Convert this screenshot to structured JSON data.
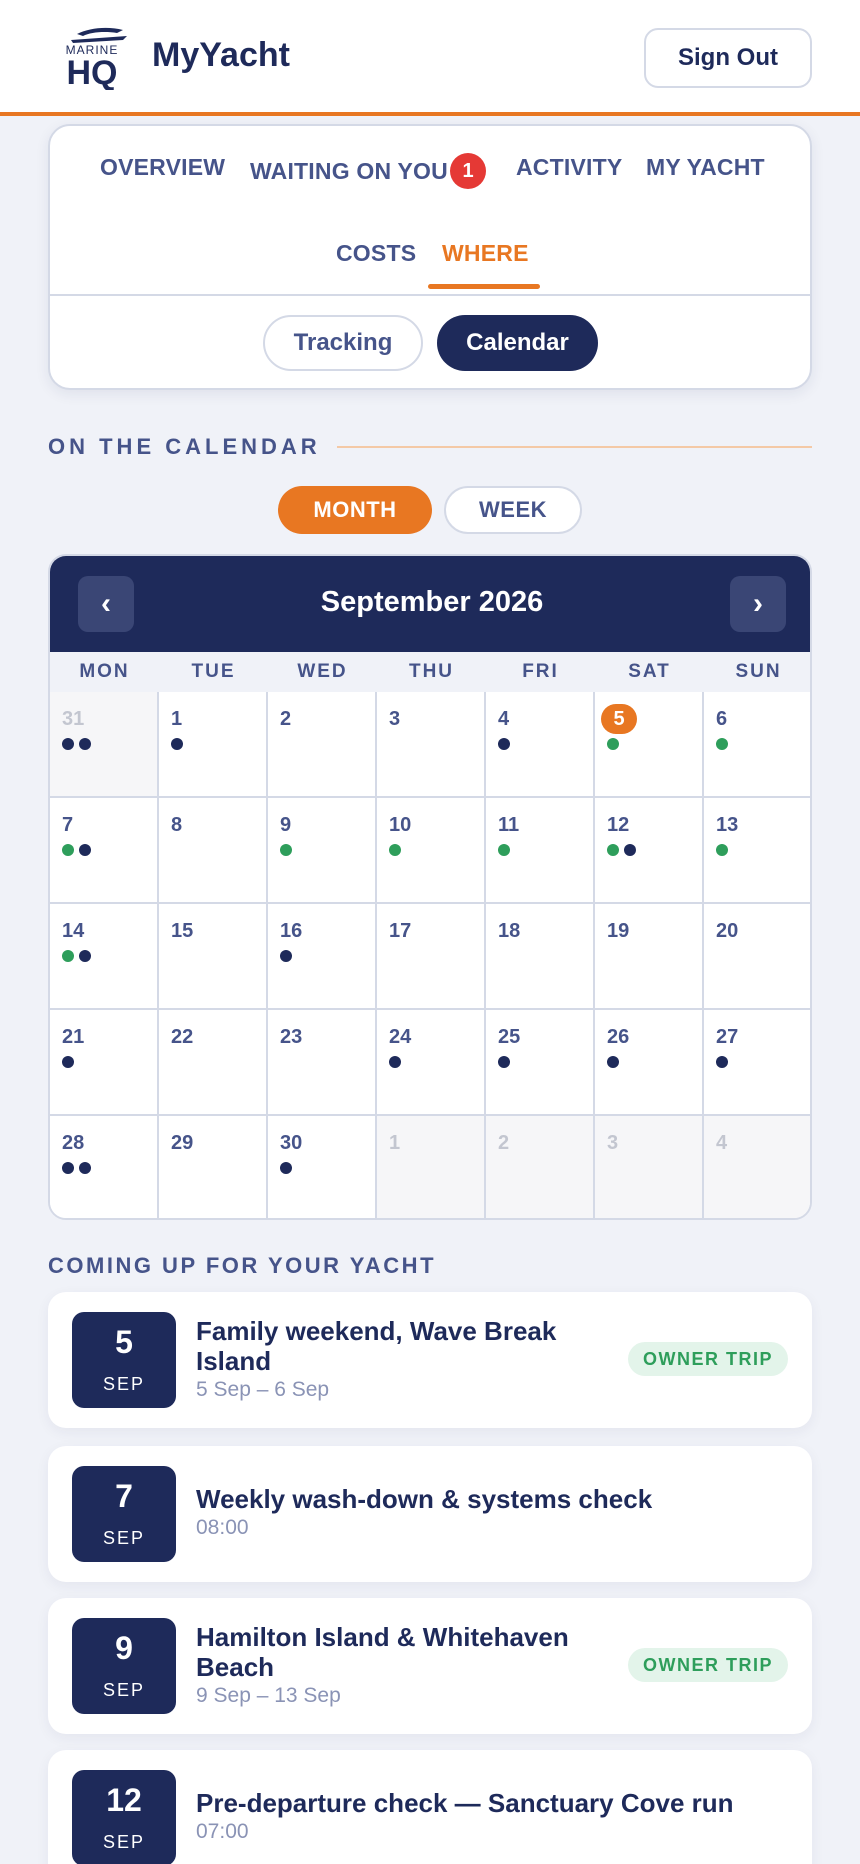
{
  "header": {
    "logo_text_top": "MARINE",
    "logo_text_main": "HQ",
    "app_title": "MyYacht",
    "sign_out_label": "Sign Out"
  },
  "nav": {
    "tabs": [
      {
        "label": "OVERVIEW",
        "active": false
      },
      {
        "label": "WAITING ON YOU",
        "active": false,
        "badge": "1"
      },
      {
        "label": "ACTIVITY",
        "active": false
      },
      {
        "label": "MY YACHT",
        "active": false
      },
      {
        "label": "COSTS",
        "active": false
      },
      {
        "label": "WHERE",
        "active": true
      }
    ],
    "segments": [
      {
        "label": "Tracking",
        "selected": false
      },
      {
        "label": "Calendar",
        "selected": true
      }
    ]
  },
  "calendar_section": {
    "title": "ON THE CALENDAR",
    "view_toggle": [
      {
        "label": "MONTH",
        "selected": true
      },
      {
        "label": "WEEK",
        "selected": false
      }
    ],
    "month_title": "September 2026",
    "prev_icon": "‹",
    "next_icon": "›",
    "weekdays": [
      "MON",
      "TUE",
      "WED",
      "THU",
      "FRI",
      "SAT",
      "SUN"
    ],
    "days": [
      {
        "n": "31",
        "muted": true,
        "dots": [
          "navy",
          "navy"
        ]
      },
      {
        "n": "1",
        "dots": [
          "navy"
        ]
      },
      {
        "n": "2",
        "dots": []
      },
      {
        "n": "3",
        "dots": []
      },
      {
        "n": "4",
        "dots": [
          "navy"
        ]
      },
      {
        "n": "5",
        "today": true,
        "dots": [
          "green"
        ]
      },
      {
        "n": "6",
        "dots": [
          "green"
        ]
      },
      {
        "n": "7",
        "dots": [
          "green",
          "navy"
        ]
      },
      {
        "n": "8",
        "dots": []
      },
      {
        "n": "9",
        "dots": [
          "green"
        ]
      },
      {
        "n": "10",
        "dots": [
          "green"
        ]
      },
      {
        "n": "11",
        "dots": [
          "green"
        ]
      },
      {
        "n": "12",
        "dots": [
          "green",
          "navy"
        ]
      },
      {
        "n": "13",
        "dots": [
          "green"
        ]
      },
      {
        "n": "14",
        "dots": [
          "green",
          "navy"
        ]
      },
      {
        "n": "15",
        "dots": []
      },
      {
        "n": "16",
        "dots": [
          "navy"
        ]
      },
      {
        "n": "17",
        "dots": []
      },
      {
        "n": "18",
        "dots": []
      },
      {
        "n": "19",
        "dots": []
      },
      {
        "n": "20",
        "dots": []
      },
      {
        "n": "21",
        "dots": [
          "navy"
        ]
      },
      {
        "n": "22",
        "dots": []
      },
      {
        "n": "23",
        "dots": []
      },
      {
        "n": "24",
        "dots": [
          "navy"
        ]
      },
      {
        "n": "25",
        "dots": [
          "navy"
        ]
      },
      {
        "n": "26",
        "dots": [
          "navy"
        ]
      },
      {
        "n": "27",
        "dots": [
          "navy"
        ]
      },
      {
        "n": "28",
        "dots": [
          "navy",
          "navy"
        ]
      },
      {
        "n": "29",
        "dots": []
      },
      {
        "n": "30",
        "dots": [
          "navy"
        ]
      },
      {
        "n": "1",
        "muted": true,
        "dots": []
      },
      {
        "n": "2",
        "muted": true,
        "dots": []
      },
      {
        "n": "3",
        "muted": true,
        "dots": []
      },
      {
        "n": "4",
        "muted": true,
        "dots": []
      }
    ]
  },
  "upcoming": {
    "title": "COMING UP FOR YOUR YACHT",
    "events": [
      {
        "day": "5",
        "month": "SEP",
        "title_lines": [
          "Family weekend, Wave Break",
          "Island"
        ],
        "subtitle": "5 Sep – 6 Sep",
        "tag": "OWNER TRIP"
      },
      {
        "day": "7",
        "month": "SEP",
        "title_lines": [
          "Weekly wash-down & systems check"
        ],
        "subtitle": "08:00",
        "tag": ""
      },
      {
        "day": "9",
        "month": "SEP",
        "title_lines": [
          "Hamilton Island & Whitehaven",
          "Beach"
        ],
        "subtitle": "9 Sep – 13 Sep",
        "tag": "OWNER TRIP"
      },
      {
        "day": "12",
        "month": "SEP",
        "title_lines": [
          "Pre-departure check — Sanctuary Cove run"
        ],
        "subtitle": "07:00",
        "tag": ""
      }
    ]
  },
  "colors": {
    "navy": "#1e2a5a",
    "accent_orange": "#e87722",
    "event_green": "#2e9e5b",
    "badge_red": "#e53935"
  }
}
